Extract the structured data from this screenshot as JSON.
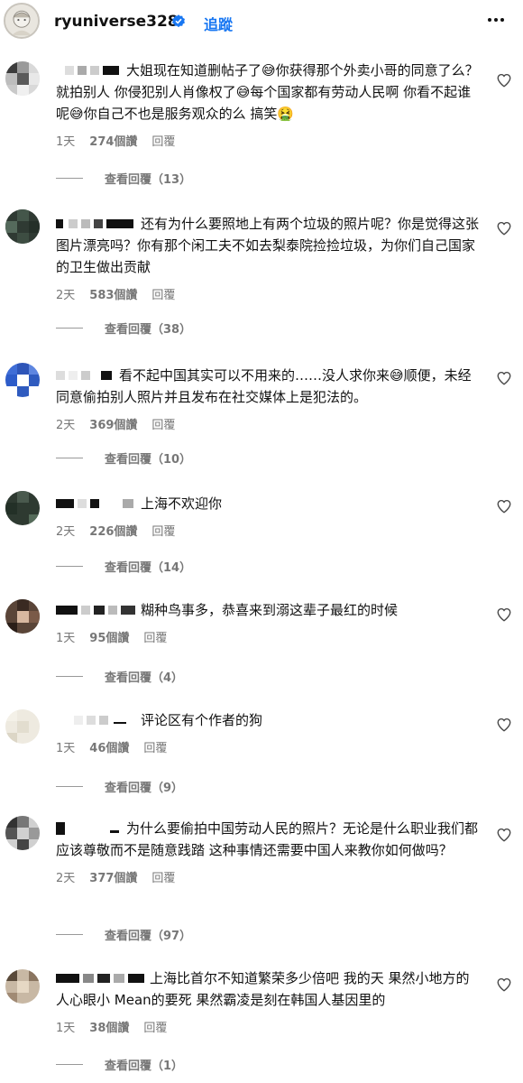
{
  "header": {
    "username": "ryuniverse328",
    "follow_label": "追蹤"
  },
  "comments": [
    {
      "text": "大姐现在知道删帖子了😅你获得那个外卖小哥的同意了么？就拍别人 你侵犯别人肖像权了😅每个国家都有劳动人民啊 你看不起谁呢😅你自己不也是服务观众的么 搞笑🤮",
      "time": "1天",
      "likes": "274個讚",
      "reply": "回覆",
      "replies": "查看回覆（13）"
    },
    {
      "text": "还有为什么要照地上有两个垃圾的照片呢？你是觉得这张图片漂亮吗？你有那个闲工夫不如去梨泰院捡捡垃圾，为你们自己国家的卫生做出贡献",
      "time": "2天",
      "likes": "583個讚",
      "reply": "回覆",
      "replies": "查看回覆（38）"
    },
    {
      "text": "看不起中国其实可以不用来的……没人求你来😅顺便，未经同意偷拍别人照片并且发布在社交媒体上是犯法的。",
      "time": "2天",
      "likes": "369個讚",
      "reply": "回覆",
      "replies": "查看回覆（10）"
    },
    {
      "text": "上海不欢迎你",
      "time": "2天",
      "likes": "226個讚",
      "reply": "回覆",
      "replies": "查看回覆（14）"
    },
    {
      "text": "糊种鸟事多，恭喜来到溺这辈子最红的时候",
      "time": "1天",
      "likes": "95個讚",
      "reply": "回覆",
      "replies": "查看回覆（4）"
    },
    {
      "text": "评论区有个作者的狗",
      "time": "1天",
      "likes": "46個讚",
      "reply": "回覆",
      "replies": "查看回覆（9）"
    },
    {
      "text": "为什么要偷拍中国劳动人民的照片？无论是什么职业我们都应该尊敬而不是随意践踏 这种事情还需要中国人来教你如何做吗？",
      "time": "2天",
      "likes": "377個讚",
      "reply": "回覆",
      "replies": "查看回覆（97）"
    },
    {
      "text": "上海比首尔不知道繁荣多少倍吧 我的天 果然小地方的人心眼小 Mean的要死 果然霸凌是刻在韩国人基因里的",
      "time": "1天",
      "likes": "38個讚",
      "reply": "回覆",
      "replies": "查看回覆（1）"
    }
  ],
  "colors": {
    "accent": "#1877f2",
    "meta": "#777777",
    "text": "#111111"
  },
  "icons": {
    "verified": "verified-badge-icon",
    "more": "more-dots-icon",
    "like": "heart-icon"
  }
}
